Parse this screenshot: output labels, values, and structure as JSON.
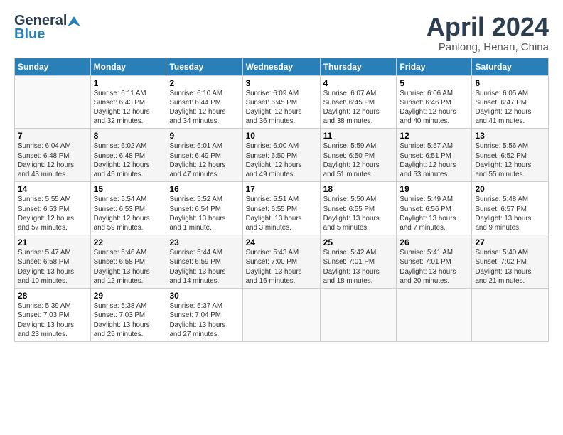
{
  "header": {
    "logo_general": "General",
    "logo_blue": "Blue",
    "month_title": "April 2024",
    "location": "Panlong, Henan, China"
  },
  "columns": [
    "Sunday",
    "Monday",
    "Tuesday",
    "Wednesday",
    "Thursday",
    "Friday",
    "Saturday"
  ],
  "weeks": [
    [
      {
        "day": "",
        "info": ""
      },
      {
        "day": "1",
        "info": "Sunrise: 6:11 AM\nSunset: 6:43 PM\nDaylight: 12 hours\nand 32 minutes."
      },
      {
        "day": "2",
        "info": "Sunrise: 6:10 AM\nSunset: 6:44 PM\nDaylight: 12 hours\nand 34 minutes."
      },
      {
        "day": "3",
        "info": "Sunrise: 6:09 AM\nSunset: 6:45 PM\nDaylight: 12 hours\nand 36 minutes."
      },
      {
        "day": "4",
        "info": "Sunrise: 6:07 AM\nSunset: 6:45 PM\nDaylight: 12 hours\nand 38 minutes."
      },
      {
        "day": "5",
        "info": "Sunrise: 6:06 AM\nSunset: 6:46 PM\nDaylight: 12 hours\nand 40 minutes."
      },
      {
        "day": "6",
        "info": "Sunrise: 6:05 AM\nSunset: 6:47 PM\nDaylight: 12 hours\nand 41 minutes."
      }
    ],
    [
      {
        "day": "7",
        "info": "Sunrise: 6:04 AM\nSunset: 6:48 PM\nDaylight: 12 hours\nand 43 minutes."
      },
      {
        "day": "8",
        "info": "Sunrise: 6:02 AM\nSunset: 6:48 PM\nDaylight: 12 hours\nand 45 minutes."
      },
      {
        "day": "9",
        "info": "Sunrise: 6:01 AM\nSunset: 6:49 PM\nDaylight: 12 hours\nand 47 minutes."
      },
      {
        "day": "10",
        "info": "Sunrise: 6:00 AM\nSunset: 6:50 PM\nDaylight: 12 hours\nand 49 minutes."
      },
      {
        "day": "11",
        "info": "Sunrise: 5:59 AM\nSunset: 6:50 PM\nDaylight: 12 hours\nand 51 minutes."
      },
      {
        "day": "12",
        "info": "Sunrise: 5:57 AM\nSunset: 6:51 PM\nDaylight: 12 hours\nand 53 minutes."
      },
      {
        "day": "13",
        "info": "Sunrise: 5:56 AM\nSunset: 6:52 PM\nDaylight: 12 hours\nand 55 minutes."
      }
    ],
    [
      {
        "day": "14",
        "info": "Sunrise: 5:55 AM\nSunset: 6:53 PM\nDaylight: 12 hours\nand 57 minutes."
      },
      {
        "day": "15",
        "info": "Sunrise: 5:54 AM\nSunset: 6:53 PM\nDaylight: 12 hours\nand 59 minutes."
      },
      {
        "day": "16",
        "info": "Sunrise: 5:52 AM\nSunset: 6:54 PM\nDaylight: 13 hours\nand 1 minute."
      },
      {
        "day": "17",
        "info": "Sunrise: 5:51 AM\nSunset: 6:55 PM\nDaylight: 13 hours\nand 3 minutes."
      },
      {
        "day": "18",
        "info": "Sunrise: 5:50 AM\nSunset: 6:55 PM\nDaylight: 13 hours\nand 5 minutes."
      },
      {
        "day": "19",
        "info": "Sunrise: 5:49 AM\nSunset: 6:56 PM\nDaylight: 13 hours\nand 7 minutes."
      },
      {
        "day": "20",
        "info": "Sunrise: 5:48 AM\nSunset: 6:57 PM\nDaylight: 13 hours\nand 9 minutes."
      }
    ],
    [
      {
        "day": "21",
        "info": "Sunrise: 5:47 AM\nSunset: 6:58 PM\nDaylight: 13 hours\nand 10 minutes."
      },
      {
        "day": "22",
        "info": "Sunrise: 5:46 AM\nSunset: 6:58 PM\nDaylight: 13 hours\nand 12 minutes."
      },
      {
        "day": "23",
        "info": "Sunrise: 5:44 AM\nSunset: 6:59 PM\nDaylight: 13 hours\nand 14 minutes."
      },
      {
        "day": "24",
        "info": "Sunrise: 5:43 AM\nSunset: 7:00 PM\nDaylight: 13 hours\nand 16 minutes."
      },
      {
        "day": "25",
        "info": "Sunrise: 5:42 AM\nSunset: 7:01 PM\nDaylight: 13 hours\nand 18 minutes."
      },
      {
        "day": "26",
        "info": "Sunrise: 5:41 AM\nSunset: 7:01 PM\nDaylight: 13 hours\nand 20 minutes."
      },
      {
        "day": "27",
        "info": "Sunrise: 5:40 AM\nSunset: 7:02 PM\nDaylight: 13 hours\nand 21 minutes."
      }
    ],
    [
      {
        "day": "28",
        "info": "Sunrise: 5:39 AM\nSunset: 7:03 PM\nDaylight: 13 hours\nand 23 minutes."
      },
      {
        "day": "29",
        "info": "Sunrise: 5:38 AM\nSunset: 7:03 PM\nDaylight: 13 hours\nand 25 minutes."
      },
      {
        "day": "30",
        "info": "Sunrise: 5:37 AM\nSunset: 7:04 PM\nDaylight: 13 hours\nand 27 minutes."
      },
      {
        "day": "",
        "info": ""
      },
      {
        "day": "",
        "info": ""
      },
      {
        "day": "",
        "info": ""
      },
      {
        "day": "",
        "info": ""
      }
    ]
  ]
}
